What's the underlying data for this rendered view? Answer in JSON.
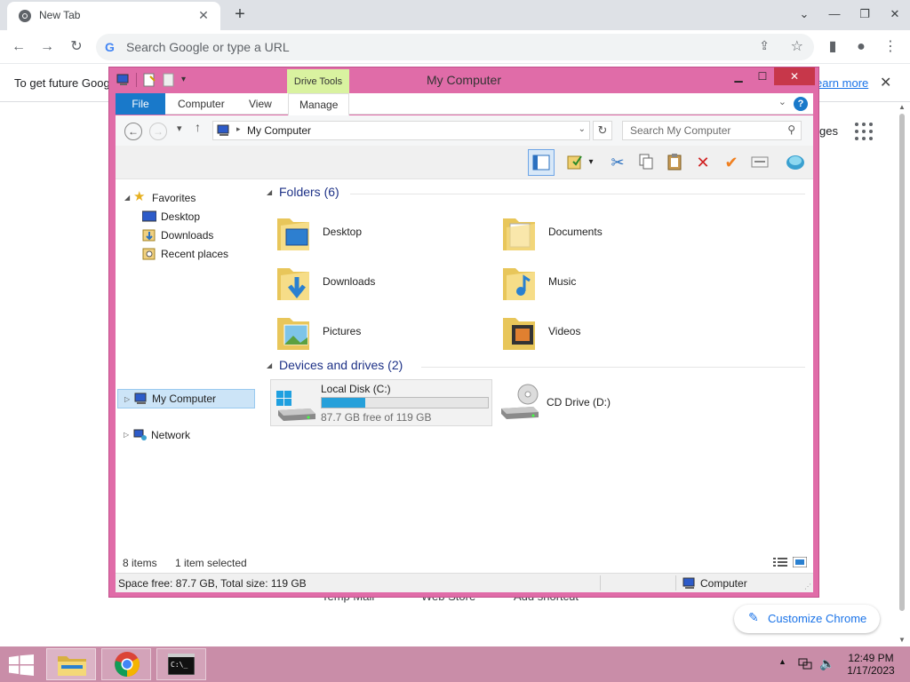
{
  "chrome": {
    "tab_title": "New Tab",
    "omnibox_placeholder": "Search Google or type a URL",
    "info_text": "To get future Goog",
    "learn_more": "earn more",
    "ntp_images": "ges",
    "shortcuts": [
      "Temp Mail",
      "Web Store",
      "Add shortcut"
    ],
    "customize_label": "Customize Chrome"
  },
  "explorer": {
    "title": "My Computer",
    "drive_tools": "Drive Tools",
    "tabs": {
      "file": "File",
      "computer": "Computer",
      "view": "View",
      "manage": "Manage"
    },
    "address": "My Computer",
    "search_placeholder": "Search My Computer",
    "nav": {
      "favorites": "Favorites",
      "desktop": "Desktop",
      "downloads": "Downloads",
      "recent": "Recent places",
      "my_computer": "My Computer",
      "network": "Network"
    },
    "folders_header": "Folders (6)",
    "folders": [
      "Desktop",
      "Documents",
      "Downloads",
      "Music",
      "Pictures",
      "Videos"
    ],
    "devices_header": "Devices and drives (2)",
    "drive_c": {
      "name": "Local Disk (C:)",
      "free": "87.7 GB free of 119 GB",
      "used_fraction": 0.263
    },
    "drive_d": {
      "name": "CD Drive (D:)"
    },
    "status": {
      "items": "8 items",
      "selected": "1 item selected",
      "space": "Space free: 87.7 GB, Total size: 119 GB",
      "location": "Computer"
    }
  },
  "taskbar": {
    "time": "12:49 PM",
    "date": "1/17/2023"
  },
  "colors": {
    "explorer_frame": "#e06ca8",
    "taskbar": "#c98da8",
    "accent_blue": "#1979ca"
  }
}
